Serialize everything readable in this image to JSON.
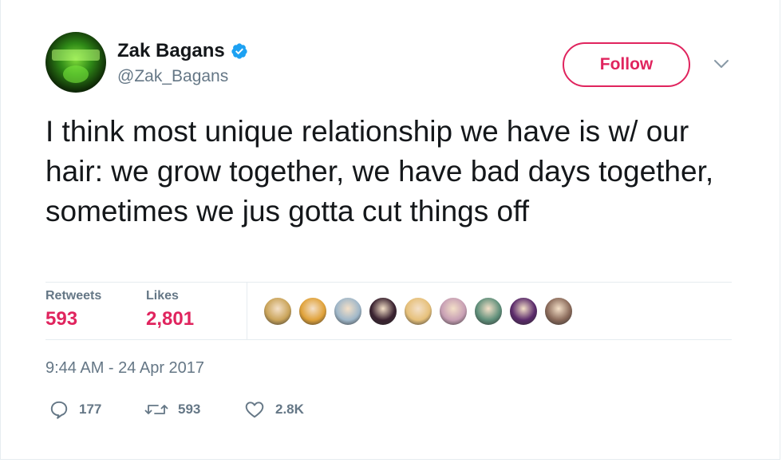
{
  "user": {
    "display_name": "Zak Bagans",
    "handle": "@Zak_Bagans",
    "verified": true,
    "avatar_icon": "profile-avatar"
  },
  "follow_label": "Follow",
  "tweet": {
    "text": "I think most unique relationship we have is w/ our hair: we grow together, we have bad days together, sometimes we jus gotta cut things off"
  },
  "stats": {
    "retweets_label": "Retweets",
    "retweets_value": "593",
    "likes_label": "Likes",
    "likes_value": "2,801"
  },
  "likers": [
    {
      "color": "#caa45a"
    },
    {
      "color": "#e0a23a"
    },
    {
      "color": "#9fb7c9"
    },
    {
      "color": "#3a2230"
    },
    {
      "color": "#e6c07a"
    },
    {
      "color": "#c79fb4"
    },
    {
      "color": "#5f8f7a"
    },
    {
      "color": "#5a2a6a"
    },
    {
      "color": "#8a6a5a"
    }
  ],
  "timestamp": "9:44 AM - 24 Apr 2017",
  "actions": {
    "reply_count": "177",
    "retweet_count": "593",
    "like_count": "2.8K"
  },
  "colors": {
    "accent": "#e0245e",
    "verified": "#1da1f2",
    "muted": "#657786"
  }
}
